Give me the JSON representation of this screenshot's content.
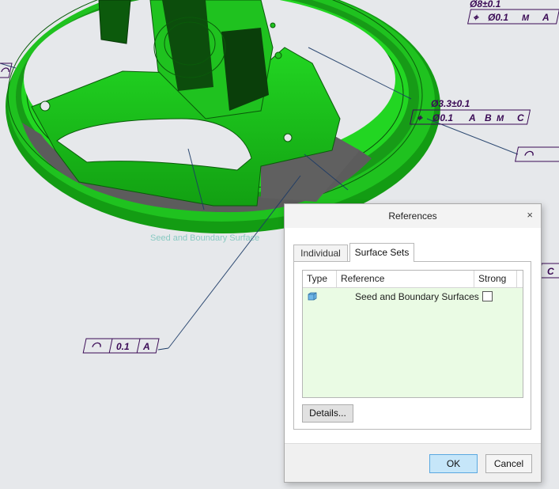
{
  "model": {
    "ghost_label": "Seed and Boundary Surface",
    "annotations": {
      "top_dia": "Ø8±0.1",
      "top_frame": {
        "tol": "Ø0.1",
        "mod": "M",
        "datum": "A"
      },
      "hole_dia": "Ø3.3±0.1",
      "hole_frame": {
        "tol": "Ø0.1",
        "d1": "A",
        "d2": "B",
        "mod": "M",
        "d3": "C"
      },
      "right_profile_char": "◠",
      "edge_c": "C",
      "left_profile": {
        "tol": "0.1",
        "datum": "A"
      }
    }
  },
  "dialog": {
    "title": "References",
    "close_glyph": "×",
    "tabs": [
      {
        "label": "Individual",
        "active": false
      },
      {
        "label": "Surface Sets",
        "active": true
      }
    ],
    "table": {
      "columns": [
        "Type",
        "Reference",
        "Strong"
      ],
      "rows": [
        {
          "type_icon": "surface-set-icon",
          "reference": "Seed and Boundary Surfaces",
          "strong": false
        }
      ]
    },
    "details_label": "Details...",
    "ok_label": "OK",
    "cancel_label": "Cancel"
  },
  "colors": {
    "model_green": "#1fc21f",
    "highlight_gray": "#5c5c5c",
    "annotation_purple": "#3a0a55",
    "ok_button": "#c6e6f9"
  }
}
